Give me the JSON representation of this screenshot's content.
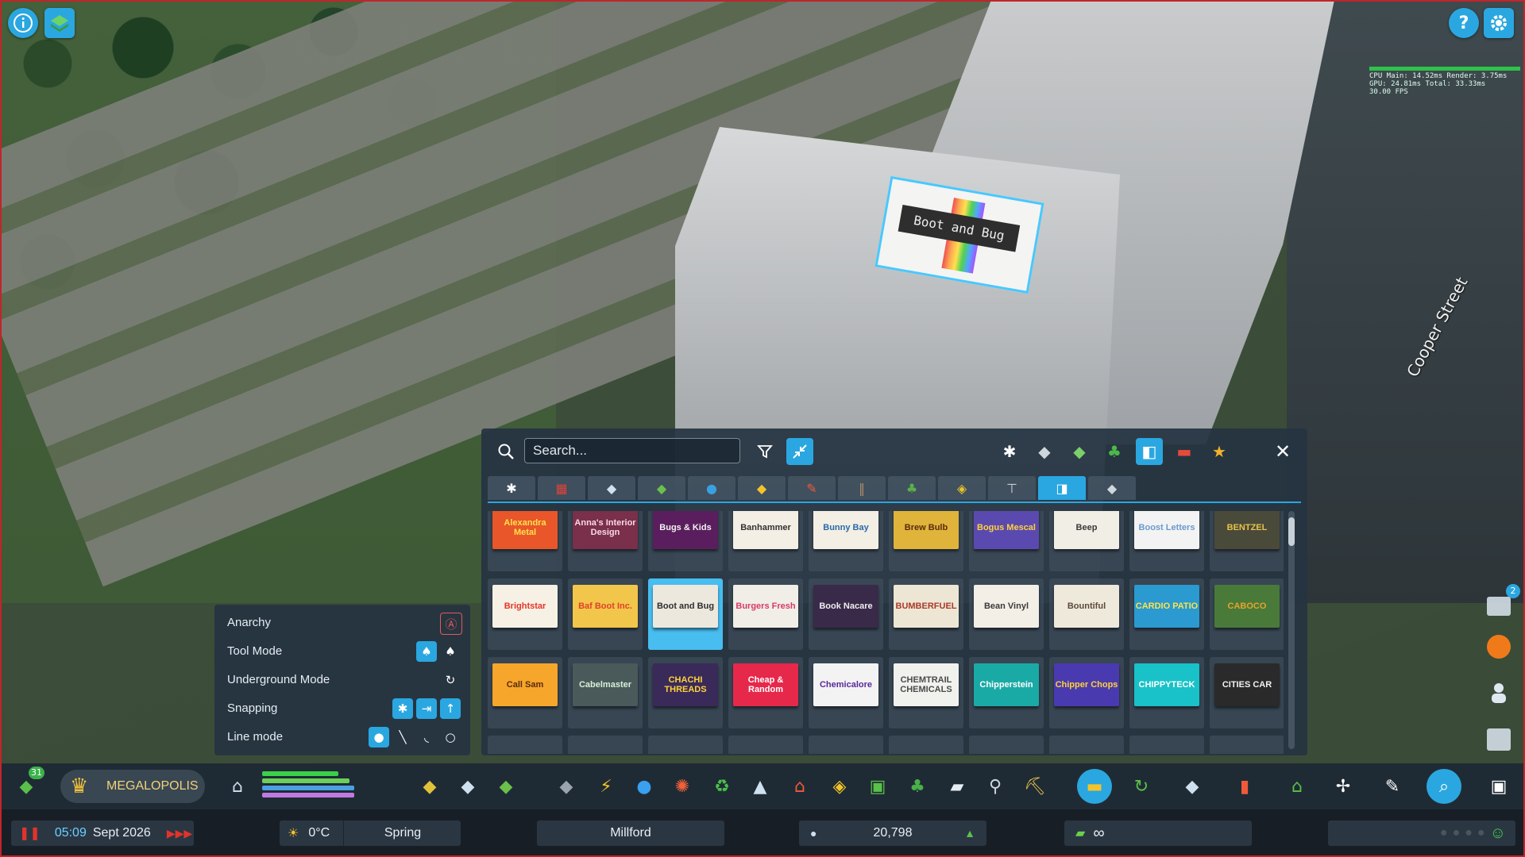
{
  "top_left": {
    "info_icon": "info-icon",
    "map_icon": "map-layers-icon"
  },
  "top_right": {
    "help_icon": "help-icon",
    "settings_icon": "gear-icon"
  },
  "perf": {
    "line1": "CPU Main: 14.52ms  Render: 3.75ms",
    "line2": "GPU: 24.81ms  Total: 33.33ms",
    "line3": "30.00 FPS"
  },
  "world": {
    "billboard_text": "Boot and Bug",
    "street_name": "Cooper Street"
  },
  "asset_panel": {
    "search_placeholder": "Search...",
    "tiles": [
      {
        "text": "Alexandra Metal",
        "bg": "#e8562a",
        "fg": "#ffe14a"
      },
      {
        "text": "Anna's Interior Design",
        "bg": "#7a2f4a",
        "fg": "#f7d8e6"
      },
      {
        "text": "Bugs & Kids",
        "bg": "#5a1e5e",
        "fg": "#f3f3f3"
      },
      {
        "text": "Banhammer",
        "bg": "#f4efe4",
        "fg": "#333333"
      },
      {
        "text": "Bunny Bay",
        "bg": "#f4efe4",
        "fg": "#2a6aa8"
      },
      {
        "text": "Brew Bulb",
        "bg": "#e0b43a",
        "fg": "#5a2a10"
      },
      {
        "text": "Bogus Mescal",
        "bg": "#5a4ab0",
        "fg": "#ffd23a"
      },
      {
        "text": "Beep",
        "bg": "#f1eee6",
        "fg": "#3a3a3a"
      },
      {
        "text": "Boost Letters",
        "bg": "#f3f3f3",
        "fg": "#6a9ad0"
      },
      {
        "text": "BENTZEL",
        "bg": "#4a4a3a",
        "fg": "#e6c24a"
      },
      {
        "text": "Brightstar",
        "bg": "#f6f1e4",
        "fg": "#e6342a"
      },
      {
        "text": "Baf Boot Inc.",
        "bg": "#f2c64a",
        "fg": "#e0422a"
      },
      {
        "text": "Boot and Bug",
        "bg": "#ece8de",
        "fg": "#2e2e2e"
      },
      {
        "text": "Burgers Fresh",
        "bg": "#f0eee6",
        "fg": "#d83a6a"
      },
      {
        "text": "Book Nacare",
        "bg": "#3a2a4a",
        "fg": "#eeeeee"
      },
      {
        "text": "BUMBERFUEL",
        "bg": "#eee6d4",
        "fg": "#a83a2a"
      },
      {
        "text": "Bean Vinyl",
        "bg": "#f3efe6",
        "fg": "#3a3a3a"
      },
      {
        "text": "Bountiful",
        "bg": "#efe9dc",
        "fg": "#5a4a3a"
      },
      {
        "text": "CARDIO PATIO",
        "bg": "#2a9ad0",
        "fg": "#ffe24a"
      },
      {
        "text": "CABOCO",
        "bg": "#4a7a3a",
        "fg": "#e6a42a"
      },
      {
        "text": "Call Sam",
        "bg": "#f6a62a",
        "fg": "#5a2a10"
      },
      {
        "text": "Cabelmaster",
        "bg": "#4a5a5a",
        "fg": "#d8f0d8"
      },
      {
        "text": "CHACHI THREADS",
        "bg": "#3a2a5a",
        "fg": "#ffd23a"
      },
      {
        "text": "Cheap & Random",
        "bg": "#e6284a",
        "fg": "#ffffff"
      },
      {
        "text": "Chemicalore",
        "bg": "#f3f3f3",
        "fg": "#5a2a9a"
      },
      {
        "text": "CHEMTRAIL CHEMICALS",
        "bg": "#f1f1ee",
        "fg": "#4a4a4a"
      },
      {
        "text": "Chipperstein",
        "bg": "#1aaaa6",
        "fg": "#ffffff"
      },
      {
        "text": "Chipper Chops",
        "bg": "#4a3ab0",
        "fg": "#ffd23a"
      },
      {
        "text": "CHIPPYTECK",
        "bg": "#18c2c8",
        "fg": "#ffffff"
      },
      {
        "text": "CITIES CAR",
        "bg": "#2a2a2a",
        "fg": "#f2f2f2"
      }
    ]
  },
  "tool_options": {
    "rows": [
      {
        "label": "Anarchy"
      },
      {
        "label": "Tool Mode"
      },
      {
        "label": "Underground Mode"
      },
      {
        "label": "Snapping"
      },
      {
        "label": "Line mode"
      }
    ]
  },
  "toolbar": {
    "milestone_label": "MEGALOPOLIS",
    "level": "31"
  },
  "status_bar": {
    "time": "05:09",
    "date": "Sept 2026",
    "temperature": "0°C",
    "season": "Spring",
    "city_name": "Millford",
    "population": "20,798",
    "money": "∞"
  },
  "notifications": {
    "count": "2"
  },
  "colors": {
    "accent": "#2aa7e0",
    "frame": "#c0252b",
    "positive": "#3bb24a"
  }
}
